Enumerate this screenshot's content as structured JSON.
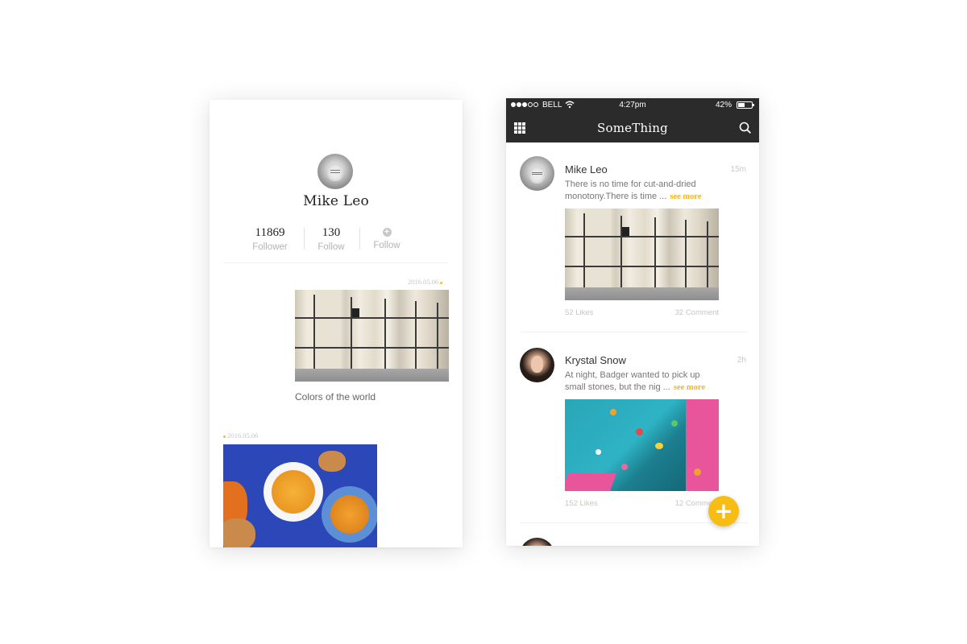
{
  "profile": {
    "name": "Mike Leo",
    "stats": [
      {
        "value": "11869",
        "label": "Follower"
      },
      {
        "value": "130",
        "label": "Follow"
      },
      {
        "value": "",
        "label": "Follow",
        "icon": "plus-circle-icon"
      }
    ],
    "posts": [
      {
        "date": "2016.05.06",
        "caption": "Colors of the world",
        "image": "mannequins-photo"
      },
      {
        "date": "2016.05.06",
        "caption": "",
        "image": "soup-bowls-photo"
      }
    ]
  },
  "status_bar": {
    "carrier": "BELL",
    "time": "4:27pm",
    "battery": "42%",
    "signal_bars_filled": 3,
    "signal_bars_total": 5,
    "battery_level": 0.42
  },
  "app": {
    "title": "SomeThing",
    "left_icon": "grid-icon",
    "right_icon": "search-icon"
  },
  "feed": [
    {
      "name": "Mike Leo",
      "time": "15m",
      "text": "There is no time for cut-and-dried monotony.There is time ...",
      "see_more": "see more",
      "image": "mannequins-photo",
      "likes": "52 Likes",
      "comments": "32 Comment"
    },
    {
      "name": "Krystal Snow",
      "time": "2h",
      "text": "At night, Badger wanted to pick up small stones, but the nig ...",
      "see_more": "see more",
      "image": "climbing-wall-photo",
      "likes": "152 Likes",
      "comments": "12 Comment"
    }
  ],
  "fab": {
    "icon": "plus-icon",
    "label": "+"
  },
  "colors": {
    "accent": "#f7bd14",
    "nav_background": "#2b2b2b",
    "muted_text": "#c6c6c6"
  }
}
